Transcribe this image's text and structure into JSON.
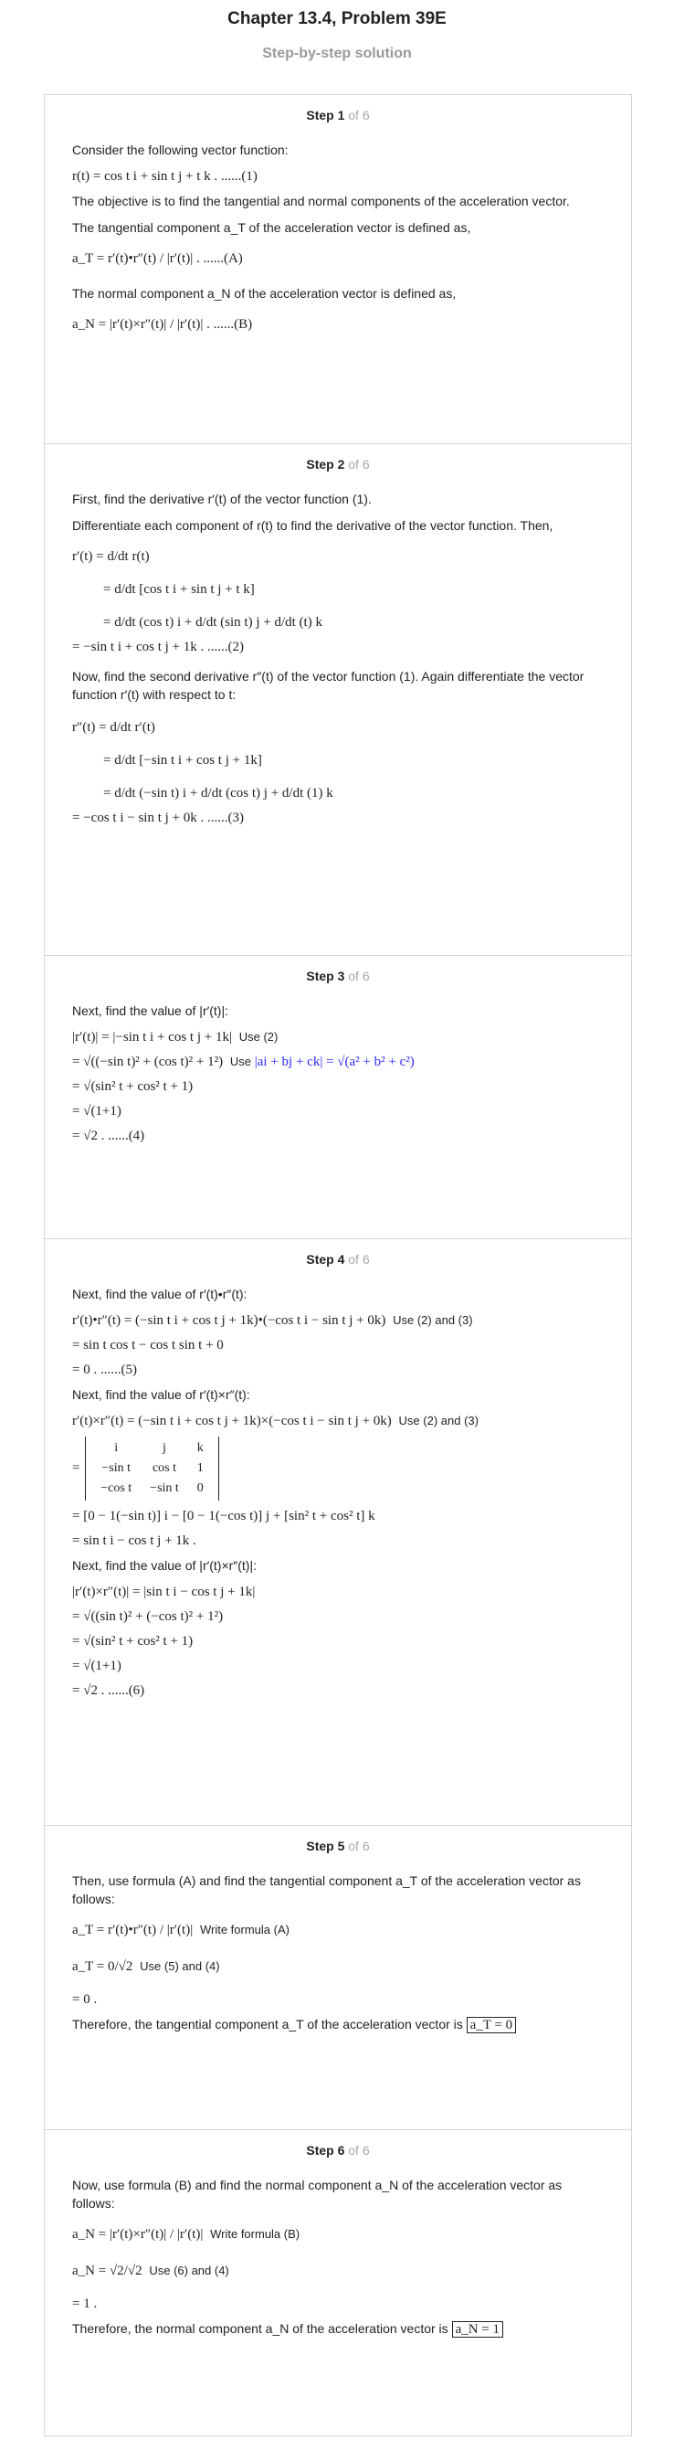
{
  "header": {
    "title": "Chapter 13.4, Problem 39E",
    "subtitle": "Step-by-step solution"
  },
  "steps": [
    {
      "label": "Step 1",
      "of": "of 6",
      "lines": [
        "Consider the following vector function:",
        "r(t) = cos t i + sin t j + t k . ......(1)",
        "The objective is to find the tangential and normal components of the acceleration vector.",
        "The tangential component  a_T of the acceleration vector is defined as,",
        "a_T = r′(t)•r″(t) / |r′(t)| . ......(A)",
        "The normal component  a_N of the acceleration vector is defined as,",
        "a_N = |r′(t)×r″(t)| / |r′(t)| . ......(B)"
      ]
    },
    {
      "label": "Step 2",
      "of": "of 6",
      "lines": [
        "First, find the derivative  r′(t) of the vector function (1).",
        "Differentiate each component of  r(t) to find the derivative of the vector function. Then,",
        "r′(t) = d/dt r(t)",
        "= d/dt [cos t i + sin t j + t k]",
        "= d/dt (cos t) i + d/dt (sin t) j + d/dt (t) k",
        "= −sin t i + cos t j + 1k . ......(2)",
        "Now, find the second derivative  r″(t) of the vector function (1). Again differentiate the vector function  r′(t) with respect to t:",
        "r″(t) = d/dt r′(t)",
        "= d/dt [−sin t i + cos t j + 1k]",
        "= d/dt (−sin t) i + d/dt (cos t) j + d/dt (1) k",
        "= −cos t i − sin t j + 0k . ......(3)"
      ]
    },
    {
      "label": "Step 3",
      "of": "of 6",
      "lines": [
        "Next, find the value of |r′(t)|:",
        "|r′(t)| = |−sin t i + cos t j + 1k|",
        "Use (2)",
        "= √((−sin t)² + (cos t)² + 1²)",
        "Use",
        "|ai + bj + ck| = √(a² + b² + c²)",
        "= √(sin² t + cos² t + 1)",
        "= √(1+1)",
        "= √2 . ......(4)"
      ]
    },
    {
      "label": "Step 4",
      "of": "of 6",
      "lines": [
        "Next, find the value of  r′(t)•r″(t):",
        "r′(t)•r″(t) = (−sin t i + cos t j + 1k)•(−cos t i − sin t j + 0k)",
        "Use (2) and (3)",
        "= sin t cos t − cos t sin t + 0",
        "= 0 . ......(5)",
        "Next, find the value of r′(t)×r″(t):",
        "r′(t)×r″(t) = (−sin t i + cos t j + 1k)×(−cos t i − sin t j + 0k)",
        "Use (2) and (3)",
        "= [0 − 1(−sin t)] i − [0 − 1(−cos t)] j + [sin² t + cos² t] k",
        "= sin t i − cos t j + 1k .",
        "Next, find the value of |r′(t)×r″(t)|:",
        "|r′(t)×r″(t)| = |sin t i − cos t j + 1k|",
        "= √((sin t)² + (−cos t)² + 1²)",
        "= √(sin² t + cos² t + 1)",
        "= √(1+1)",
        "= √2 . ......(6)"
      ],
      "matrix": [
        [
          "i",
          "j",
          "k"
        ],
        [
          "−sin t",
          "cos t",
          "1"
        ],
        [
          "−cos t",
          "−sin t",
          "0"
        ]
      ]
    },
    {
      "label": "Step 5",
      "of": "of 6",
      "lines": [
        "Then, use formula (A) and find the tangential component  a_T of the acceleration vector as follows:",
        "a_T = r′(t)•r″(t) / |r′(t)|",
        "Write formula (A)",
        "a_T = 0/√2",
        "Use (5) and (4)",
        "= 0 .",
        "Therefore, the tangential component  a_T of the acceleration vector is",
        "a_T = 0"
      ]
    },
    {
      "label": "Step 6",
      "of": "of 6",
      "lines": [
        "Now, use formula (B) and find the normal component  a_N of the acceleration vector as follows:",
        "a_N = |r′(t)×r″(t)| / |r′(t)|",
        "Write formula (B)",
        "a_N = √2/√2",
        "Use (6) and (4)",
        "= 1 .",
        "Therefore, the normal component  a_N of the acceleration vector is",
        "a_N = 1"
      ]
    }
  ],
  "colors": {
    "highlight": "#2a2aff",
    "muted": "#9a9a9a",
    "border": "#d6d6d6"
  }
}
